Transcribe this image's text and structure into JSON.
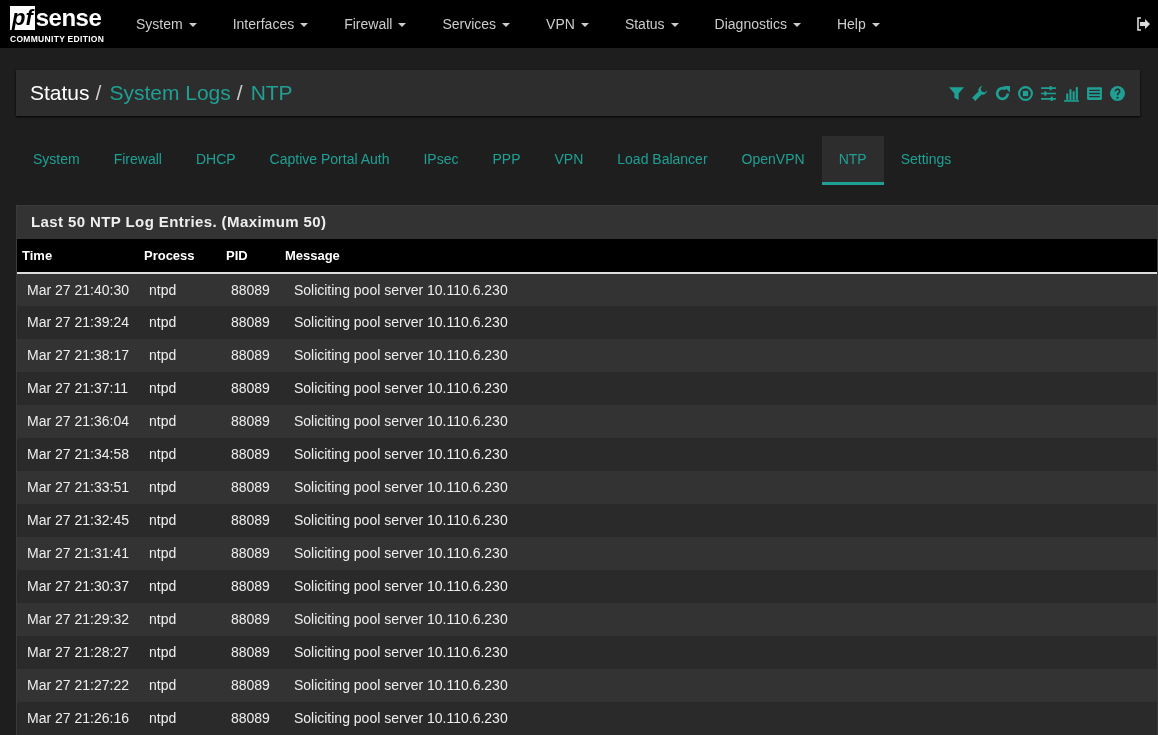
{
  "brand": {
    "mark": "pf",
    "name": "sense",
    "edition": "COMMUNITY EDITION"
  },
  "menu": [
    {
      "label": "System"
    },
    {
      "label": "Interfaces"
    },
    {
      "label": "Firewall"
    },
    {
      "label": "Services"
    },
    {
      "label": "VPN"
    },
    {
      "label": "Status"
    },
    {
      "label": "Diagnostics"
    },
    {
      "label": "Help"
    }
  ],
  "breadcrumb": [
    {
      "label": "Status",
      "separator": "/"
    },
    {
      "label": "System Logs",
      "separator": "/"
    },
    {
      "label": "NTP"
    }
  ],
  "tabs": [
    {
      "label": "System",
      "selected": false
    },
    {
      "label": "Firewall",
      "selected": false
    },
    {
      "label": "DHCP",
      "selected": false
    },
    {
      "label": "Captive Portal Auth",
      "selected": false
    },
    {
      "label": "IPsec",
      "selected": false
    },
    {
      "label": "PPP",
      "selected": false
    },
    {
      "label": "VPN",
      "selected": false
    },
    {
      "label": "Load Balancer",
      "selected": false
    },
    {
      "label": "OpenVPN",
      "selected": false
    },
    {
      "label": "NTP",
      "selected": true
    },
    {
      "label": "Settings",
      "selected": false
    }
  ],
  "panel_title": "Last 50 NTP Log Entries. (Maximum 50)",
  "table": {
    "columns": [
      "Time",
      "Process",
      "PID",
      "Message"
    ],
    "rows": [
      [
        "Mar 27 21:40:30",
        "ntpd",
        "88089",
        "Soliciting pool server 10.110.6.230"
      ],
      [
        "Mar 27 21:39:24",
        "ntpd",
        "88089",
        "Soliciting pool server 10.110.6.230"
      ],
      [
        "Mar 27 21:38:17",
        "ntpd",
        "88089",
        "Soliciting pool server 10.110.6.230"
      ],
      [
        "Mar 27 21:37:11",
        "ntpd",
        "88089",
        "Soliciting pool server 10.110.6.230"
      ],
      [
        "Mar 27 21:36:04",
        "ntpd",
        "88089",
        "Soliciting pool server 10.110.6.230"
      ],
      [
        "Mar 27 21:34:58",
        "ntpd",
        "88089",
        "Soliciting pool server 10.110.6.230"
      ],
      [
        "Mar 27 21:33:51",
        "ntpd",
        "88089",
        "Soliciting pool server 10.110.6.230"
      ],
      [
        "Mar 27 21:32:45",
        "ntpd",
        "88089",
        "Soliciting pool server 10.110.6.230"
      ],
      [
        "Mar 27 21:31:41",
        "ntpd",
        "88089",
        "Soliciting pool server 10.110.6.230"
      ],
      [
        "Mar 27 21:30:37",
        "ntpd",
        "88089",
        "Soliciting pool server 10.110.6.230"
      ],
      [
        "Mar 27 21:29:32",
        "ntpd",
        "88089",
        "Soliciting pool server 10.110.6.230"
      ],
      [
        "Mar 27 21:28:27",
        "ntpd",
        "88089",
        "Soliciting pool server 10.110.6.230"
      ],
      [
        "Mar 27 21:27:22",
        "ntpd",
        "88089",
        "Soliciting pool server 10.110.6.230"
      ],
      [
        "Mar 27 21:26:16",
        "ntpd",
        "88089",
        "Soliciting pool server 10.110.6.230"
      ]
    ]
  }
}
